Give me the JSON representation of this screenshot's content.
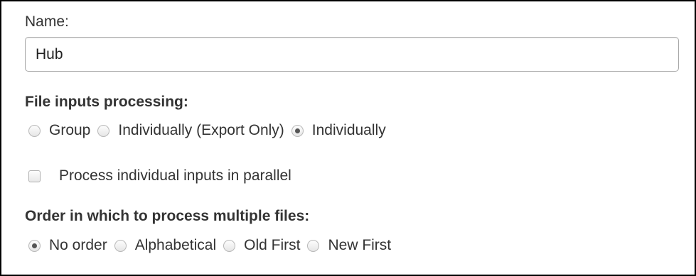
{
  "name_field": {
    "label": "Name:",
    "value": "Hub"
  },
  "file_inputs": {
    "title": "File inputs processing:",
    "options": [
      {
        "label": "Group",
        "checked": false
      },
      {
        "label": "Individually (Export Only)",
        "checked": false
      },
      {
        "label": "Individually",
        "checked": true
      }
    ]
  },
  "parallel": {
    "label": "Process individual inputs in parallel",
    "checked": false
  },
  "order": {
    "title": "Order in which to process multiple files:",
    "options": [
      {
        "label": "No order",
        "checked": true
      },
      {
        "label": "Alphabetical",
        "checked": false
      },
      {
        "label": "Old First",
        "checked": false
      },
      {
        "label": "New First",
        "checked": false
      }
    ]
  }
}
